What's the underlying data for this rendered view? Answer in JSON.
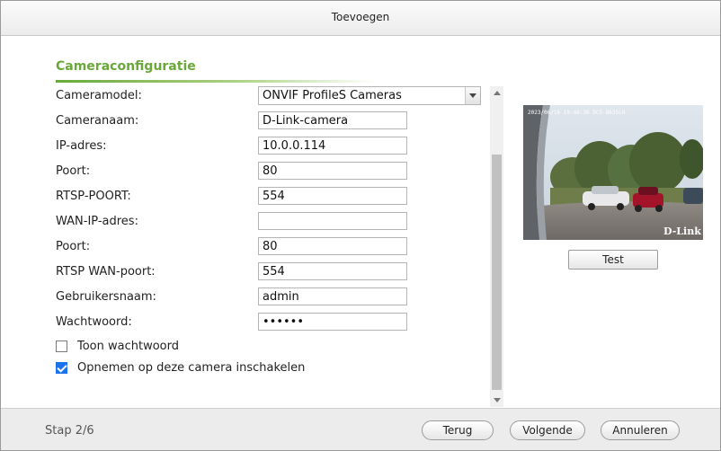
{
  "dialog": {
    "title": "Toevoegen",
    "section_title": "Cameraconfiguratie",
    "step": "Stap 2/6"
  },
  "form": {
    "camera_model": {
      "label": "Cameramodel:",
      "value": "ONVIF ProfileS Cameras"
    },
    "camera_name": {
      "label": "Cameranaam:",
      "value": "D-Link-camera"
    },
    "ip_address": {
      "label": "IP-adres:",
      "value": "10.0.0.114"
    },
    "port": {
      "label": "Poort:",
      "value": "80"
    },
    "rtsp_port": {
      "label": "RTSP-POORT:",
      "value": "554"
    },
    "wan_ip": {
      "label": "WAN-IP-adres:",
      "value": ""
    },
    "wan_port": {
      "label": "Poort:",
      "value": "80"
    },
    "rtsp_wan_port": {
      "label": "RTSP WAN-poort:",
      "value": "554"
    },
    "username": {
      "label": "Gebruikersnaam:",
      "value": "admin"
    },
    "password": {
      "label": "Wachtwoord:",
      "value": "••••••"
    },
    "show_password": {
      "label": "Toon wachtwoord",
      "checked": false
    },
    "enable_recording": {
      "label": "Opnemen op deze camera inschakelen",
      "checked": true
    }
  },
  "preview": {
    "timestamp": "2023/06/16 19:48:30 DCS-8635LH",
    "watermark": "D-Link"
  },
  "buttons": {
    "test": "Test",
    "back": "Terug",
    "next": "Volgende",
    "cancel": "Annuleren"
  },
  "colors": {
    "accent_green": "#6aa83a",
    "checkbox_blue": "#1a73e8"
  }
}
